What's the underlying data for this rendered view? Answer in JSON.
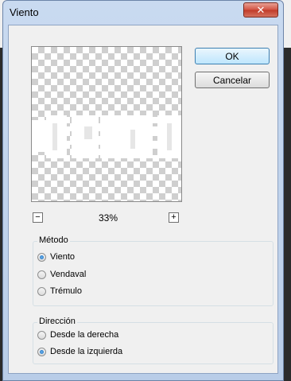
{
  "window": {
    "title": "Viento"
  },
  "buttons": {
    "ok": "OK",
    "cancel": "Cancelar"
  },
  "preview": {
    "zoom": "33%"
  },
  "method": {
    "label": "Método",
    "options": [
      "Viento",
      "Vendaval",
      "Trémulo"
    ],
    "selected": "Viento"
  },
  "direction": {
    "label": "Dirección",
    "options": [
      "Desde la derecha",
      "Desde la izquierda"
    ],
    "selected": "Desde la izquierda"
  },
  "icons": {
    "close": "close-icon",
    "zoom_out": "minus-icon",
    "zoom_in": "plus-icon"
  }
}
